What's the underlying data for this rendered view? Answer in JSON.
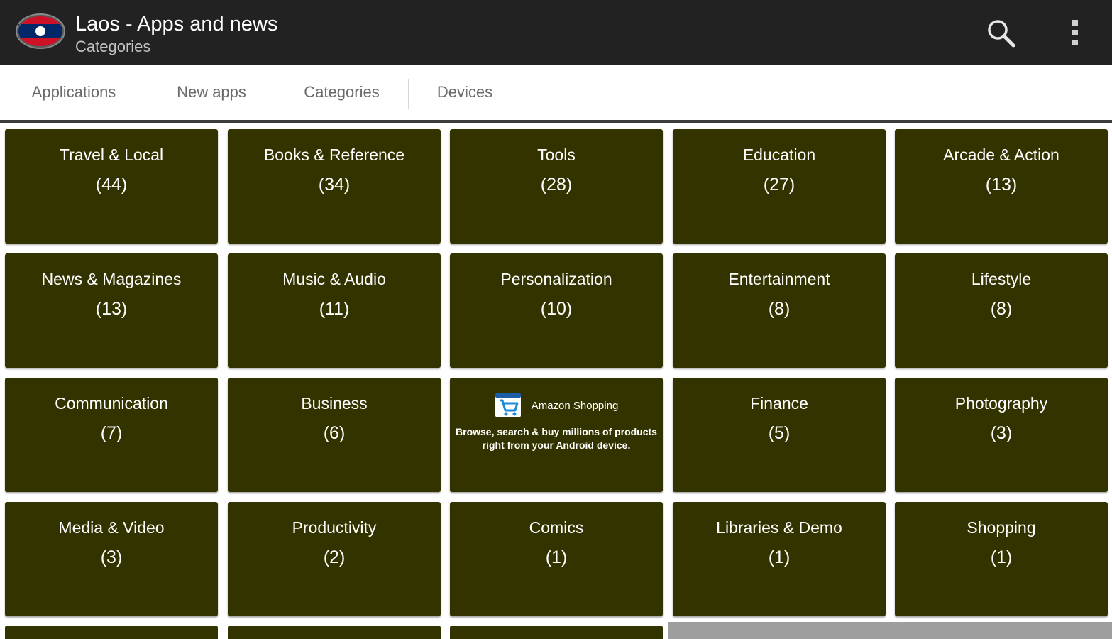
{
  "appbar": {
    "title": "Laos - Apps and news",
    "subtitle": "Categories",
    "app_icon": "laos-flag-icon",
    "search_icon": "search-icon",
    "overflow_icon": "overflow-menu-icon",
    "background": "#222222"
  },
  "tabs": [
    {
      "label": "Applications"
    },
    {
      "label": "New apps"
    },
    {
      "label": "Categories"
    },
    {
      "label": "Devices"
    }
  ],
  "categories": [
    {
      "name": "Travel & Local",
      "count": "(44)"
    },
    {
      "name": "Books & Reference",
      "count": "(34)"
    },
    {
      "name": "Tools",
      "count": "(28)"
    },
    {
      "name": "Education",
      "count": "(27)"
    },
    {
      "name": "Arcade & Action",
      "count": "(13)"
    },
    {
      "name": "News & Magazines",
      "count": "(13)"
    },
    {
      "name": "Music & Audio",
      "count": "(11)"
    },
    {
      "name": "Personalization",
      "count": "(10)"
    },
    {
      "name": "Entertainment",
      "count": "(8)"
    },
    {
      "name": "Lifestyle",
      "count": "(8)"
    },
    {
      "name": "Communication",
      "count": "(7)"
    },
    {
      "name": "Business",
      "count": "(6)"
    },
    {
      "name": "Finance",
      "count": "(5)"
    },
    {
      "name": "Photography",
      "count": "(3)"
    },
    {
      "name": "Media & Video",
      "count": "(3)"
    },
    {
      "name": "Productivity",
      "count": "(2)"
    },
    {
      "name": "Comics",
      "count": "(1)"
    },
    {
      "name": "Libraries & Demo",
      "count": "(1)"
    },
    {
      "name": "Shopping",
      "count": "(1)"
    }
  ],
  "ad": {
    "name": "Amazon Shopping",
    "icon": "shopping-cart-icon",
    "description": "Browse, search & buy millions of products right from your Android device."
  },
  "colors": {
    "tile": "#333300",
    "tab_text": "#6a6a6a",
    "flag_red": "#ce1126",
    "flag_blue": "#002868"
  }
}
